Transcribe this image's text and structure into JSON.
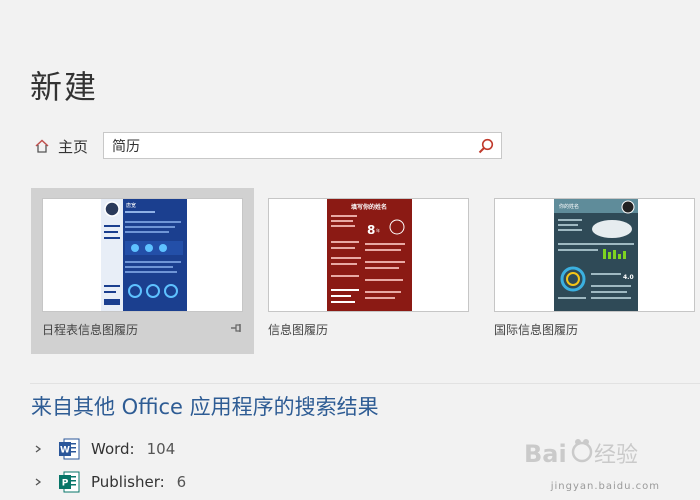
{
  "page": {
    "title": "新建"
  },
  "nav": {
    "home_label": "主页",
    "home_icon": "home-icon"
  },
  "search": {
    "value": "简历",
    "icon": "search-icon"
  },
  "templates": [
    {
      "name": "日程表信息图履历",
      "selected": true
    },
    {
      "name": "信息图履历",
      "selected": false
    },
    {
      "name": "国际信息图履历",
      "selected": false
    }
  ],
  "thumbs": {
    "t1_name": "唐宽",
    "t2_title": "填写你的姓名",
    "t2_number": "8",
    "t2_unit": "年",
    "t3_title": "你的姓名",
    "t3_score": "4.0"
  },
  "other_results": {
    "heading": "来自其他 Office 应用程序的搜索结果",
    "items": [
      {
        "app": "Word:",
        "count": "104",
        "icon": "word-icon",
        "color": "#2b579a"
      },
      {
        "app": "Publisher:",
        "count": "6",
        "icon": "publisher-icon",
        "color": "#077568"
      }
    ]
  },
  "watermark": {
    "brand": "Bai经验",
    "url": "jingyan.baidu.com"
  }
}
